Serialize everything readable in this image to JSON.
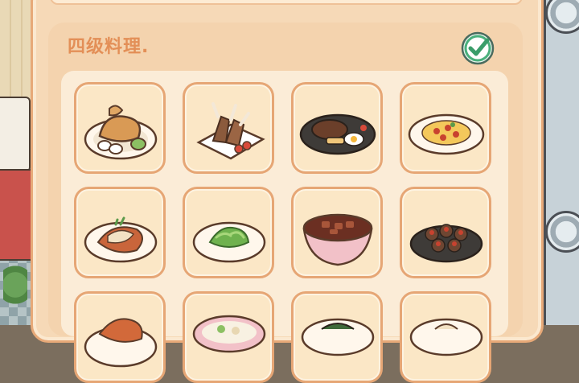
{
  "section": {
    "title": "四级料理.",
    "completed_icon": "check-circle-icon"
  },
  "dishes": [
    {
      "icon": "roast-chicken-plate-icon"
    },
    {
      "icon": "lamb-chops-plate-icon"
    },
    {
      "icon": "steak-egg-plate-icon"
    },
    {
      "icon": "tomato-stirfry-plate-icon"
    },
    {
      "icon": "braised-fish-plate-icon"
    },
    {
      "icon": "green-pepper-stirfry-plate-icon"
    },
    {
      "icon": "braised-pork-bowl-icon"
    },
    {
      "icon": "stuffed-mushrooms-plate-icon"
    },
    {
      "icon": "braised-ribs-plate-icon"
    },
    {
      "icon": "soup-plate-icon"
    },
    {
      "icon": "noodle-plate-icon"
    },
    {
      "icon": "dumpling-plate-icon"
    }
  ],
  "colors": {
    "panel": "#f6d9b7",
    "tile_border": "#e6a675",
    "title": "#e38f57",
    "check": "#4ab07c"
  }
}
